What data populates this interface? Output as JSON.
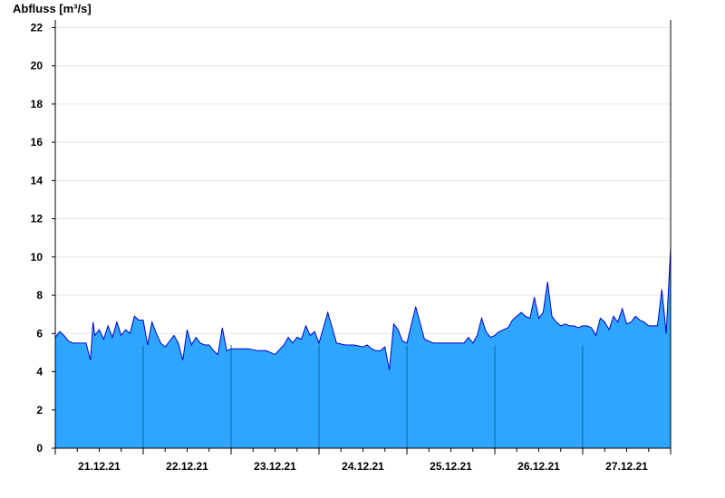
{
  "chart_data": {
    "type": "area",
    "title": "",
    "xlabel": "",
    "ylabel": "Abfluss [m³/s]",
    "ylim": [
      0,
      22.4
    ],
    "yticks": [
      0,
      2,
      4,
      6,
      8,
      10,
      12,
      14,
      16,
      18,
      20,
      22
    ],
    "xlim": [
      "20.12.21 00:00",
      "28.12.21 00:00"
    ],
    "day_labels": [
      "21.12.21",
      "22.12.21",
      "23.12.21",
      "24.12.21",
      "25.12.21",
      "26.12.21",
      "27.12.21"
    ],
    "grid": true,
    "fill_color": "#2ea6ff",
    "line_color": "#0000cc",
    "series": [
      {
        "x": [
          0,
          0.05,
          0.1,
          0.15,
          0.2,
          0.25,
          0.3,
          0.35,
          0.4,
          0.43,
          0.45,
          0.5,
          0.55,
          0.6,
          0.65,
          0.7,
          0.75,
          0.8,
          0.85,
          0.9,
          0.95,
          1.0,
          1.05,
          1.1,
          1.15,
          1.2,
          1.25,
          1.3,
          1.35,
          1.4,
          1.45,
          1.5,
          1.55,
          1.6,
          1.65,
          1.7,
          1.75,
          1.8,
          1.85,
          1.9,
          1.95,
          2.0,
          2.1,
          2.2,
          2.3,
          2.4,
          2.5,
          2.6,
          2.65,
          2.7,
          2.75,
          2.8,
          2.85,
          2.9,
          2.95,
          3.0,
          3.1,
          3.2,
          3.3,
          3.4,
          3.5,
          3.55,
          3.6,
          3.65,
          3.7,
          3.75,
          3.8,
          3.85,
          3.9,
          3.95,
          4.0,
          4.1,
          4.2,
          4.3,
          4.4,
          4.45,
          4.5,
          4.55,
          4.6,
          4.65,
          4.7,
          4.75,
          4.8,
          4.85,
          4.9,
          4.95,
          5.0,
          5.05,
          5.1,
          5.15,
          5.2,
          5.25,
          5.3,
          5.35,
          5.4,
          5.45,
          5.5,
          5.55,
          5.6,
          5.65,
          5.7,
          5.75,
          5.8,
          5.85,
          5.9,
          5.95,
          6.0,
          6.05,
          6.1,
          6.15,
          6.2,
          6.25,
          6.3,
          6.35,
          6.4,
          6.45,
          6.5,
          6.55,
          6.6,
          6.65,
          6.7,
          6.75,
          6.8,
          6.85,
          6.9,
          6.95,
          7.0
        ],
        "y": [
          5.8,
          6.1,
          5.9,
          5.6,
          5.5,
          5.5,
          5.5,
          5.5,
          4.6,
          6.6,
          5.9,
          6.2,
          5.7,
          6.4,
          5.8,
          6.6,
          5.9,
          6.2,
          6.0,
          6.9,
          6.7,
          6.7,
          5.4,
          6.6,
          6.0,
          5.5,
          5.3,
          5.6,
          5.9,
          5.5,
          4.6,
          6.2,
          5.4,
          5.8,
          5.5,
          5.4,
          5.4,
          5.1,
          4.9,
          6.3,
          5.1,
          5.2,
          5.2,
          5.2,
          5.1,
          5.1,
          4.9,
          5.4,
          5.8,
          5.5,
          5.8,
          5.7,
          6.4,
          5.9,
          6.1,
          5.5,
          7.1,
          5.5,
          5.4,
          5.4,
          5.3,
          5.4,
          5.2,
          5.1,
          5.1,
          5.3,
          4.1,
          6.5,
          6.2,
          5.6,
          5.5,
          7.4,
          5.7,
          5.5,
          5.5,
          5.5,
          5.5,
          5.5,
          5.5,
          5.5,
          5.8,
          5.5,
          5.9,
          6.8,
          6.1,
          5.8,
          5.9,
          6.1,
          6.2,
          6.3,
          6.7,
          6.9,
          7.1,
          6.9,
          6.8,
          7.9,
          6.8,
          7.1,
          8.7,
          6.9,
          6.6,
          6.4,
          6.5,
          6.4,
          6.4,
          6.3,
          6.4,
          6.4,
          6.3,
          5.9,
          6.8,
          6.6,
          6.2,
          6.9,
          6.6,
          7.3,
          6.5,
          6.6,
          6.9,
          6.7,
          6.6,
          6.4,
          6.4,
          6.4,
          8.3,
          6.0,
          10.5
        ]
      }
    ]
  }
}
